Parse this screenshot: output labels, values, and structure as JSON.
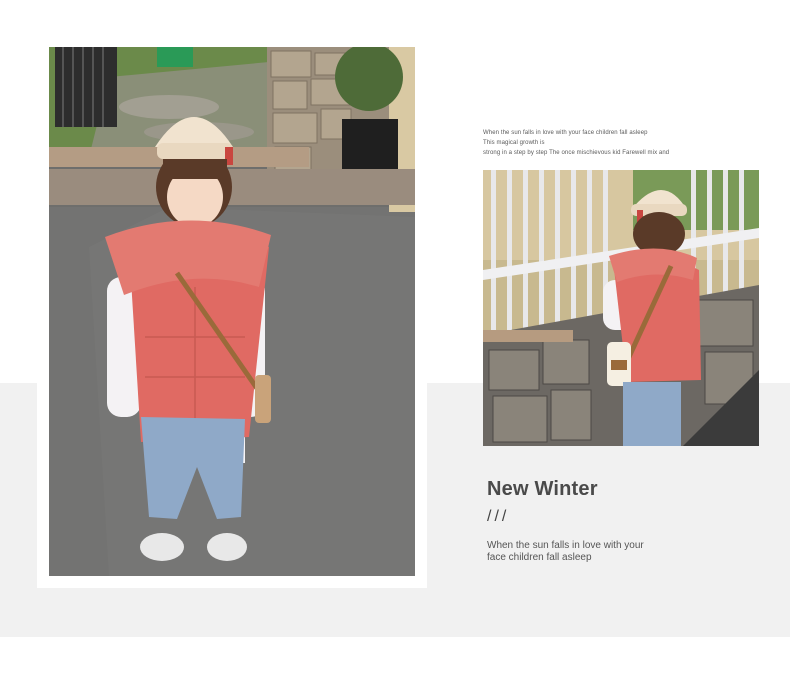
{
  "colors": {
    "band": "#f1f1f1",
    "vest": "#e06a63",
    "beanie": "#f1e3cf",
    "jeans": "#8fa9c8"
  },
  "intro_lines": [
    "When the sun falls in love with your face children fall asleep",
    "This magical growth is",
    "strong in a step by step The once mischievous kid Farewell mix and"
  ],
  "heading": {
    "title": "New Winter",
    "divider": "///"
  },
  "description": {
    "line1": "When the sun falls in love with your",
    "line2": "face children fall asleep"
  },
  "photos": {
    "left_alt": "girl-front-view",
    "right_alt": "girl-back-view"
  }
}
